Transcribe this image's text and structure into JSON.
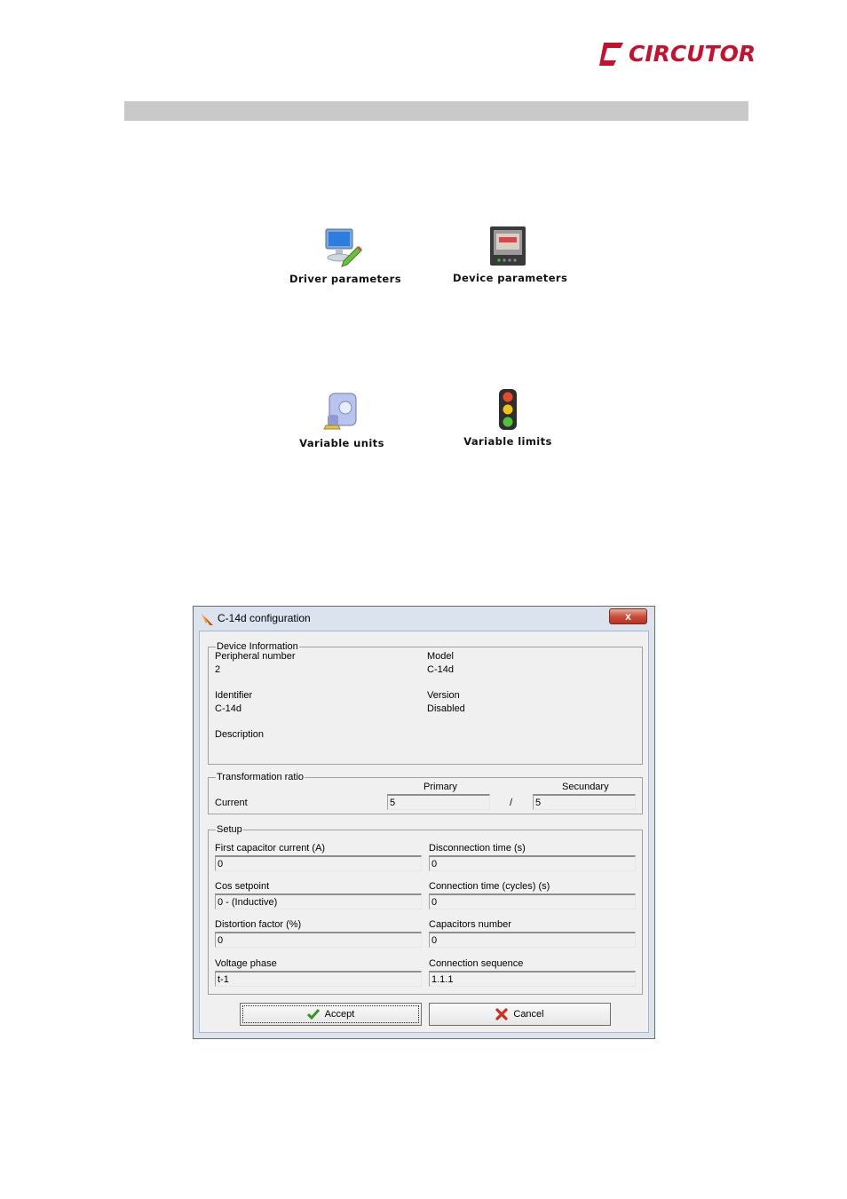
{
  "brand": {
    "logo_text": "CIRCUTOR",
    "color": "#c8102e"
  },
  "icons": [
    {
      "label": "Driver parameters",
      "icon": "computer-pencil-icon"
    },
    {
      "label": "Device parameters",
      "icon": "device-panel-icon"
    },
    {
      "label": "Variable units",
      "icon": "units-icon"
    },
    {
      "label": "Variable limits",
      "icon": "traffic-light-icon"
    }
  ],
  "dialog": {
    "title": "C-14d configuration",
    "close_label": "x",
    "device_info": {
      "group_title": "Device Information",
      "peripheral_label": "Peripheral number",
      "peripheral_value": "2",
      "model_label": "Model",
      "model_value": "C-14d",
      "identifier_label": "Identifier",
      "identifier_value": "C-14d",
      "version_label": "Version",
      "version_value": "Disabled",
      "description_label": "Description"
    },
    "transformation": {
      "group_title": "Transformation ratio",
      "primary_label": "Primary",
      "secondary_label": "Secundary",
      "current_label": "Current",
      "primary_value": "5",
      "separator": "/",
      "secondary_value": "5"
    },
    "setup": {
      "group_title": "Setup",
      "first_cap_label": "First capacitor current (A)",
      "first_cap_value": "0",
      "disconnection_label": "Disconnection time (s)",
      "disconnection_value": "0",
      "cos_label": "Cos setpoint",
      "cos_value": "0  -  (Inductive)",
      "connection_time_label": "Connection time (cycles) (s)",
      "connection_time_value": "0",
      "distortion_label": "Distortion factor (%)",
      "distortion_value": "0",
      "capacitors_label": "Capacitors number",
      "capacitors_value": "0",
      "voltage_phase_label": "Voltage phase",
      "voltage_phase_value": "t-1",
      "connection_seq_label": "Connection sequence",
      "connection_seq_value": "1.1.1"
    },
    "accept_label": "Accept",
    "cancel_label": "Cancel"
  }
}
